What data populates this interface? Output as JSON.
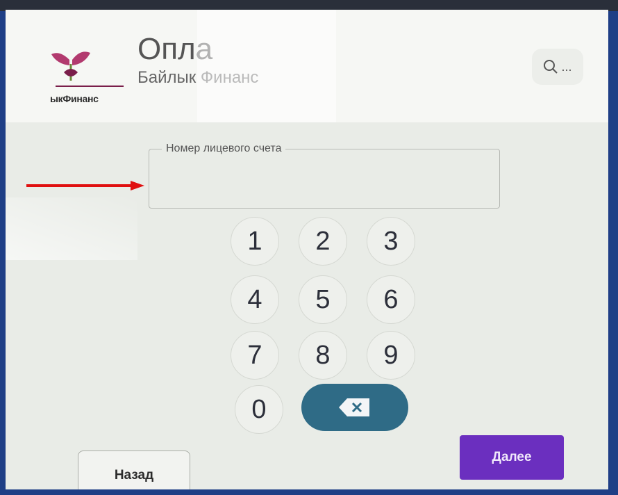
{
  "header": {
    "title": "Опла",
    "subtitle": "Байлык Финанс",
    "logo_text": "ыкФинанс",
    "search_more": "..."
  },
  "form": {
    "account_label": "Номер лицевого счета",
    "account_value": ""
  },
  "keypad": {
    "keys": [
      "1",
      "2",
      "3",
      "4",
      "5",
      "6",
      "7",
      "8",
      "9",
      "0"
    ]
  },
  "nav": {
    "back_label": "Назад",
    "next_label": "Далее"
  },
  "colors": {
    "backspace_bg": "#2f6b86",
    "next_bg": "#6b2fbf",
    "arrow": "#e01010"
  },
  "icons": {
    "logo": "sprout-logo-icon",
    "search": "search-icon",
    "backspace": "backspace-icon",
    "annotation": "red-arrow-icon"
  }
}
